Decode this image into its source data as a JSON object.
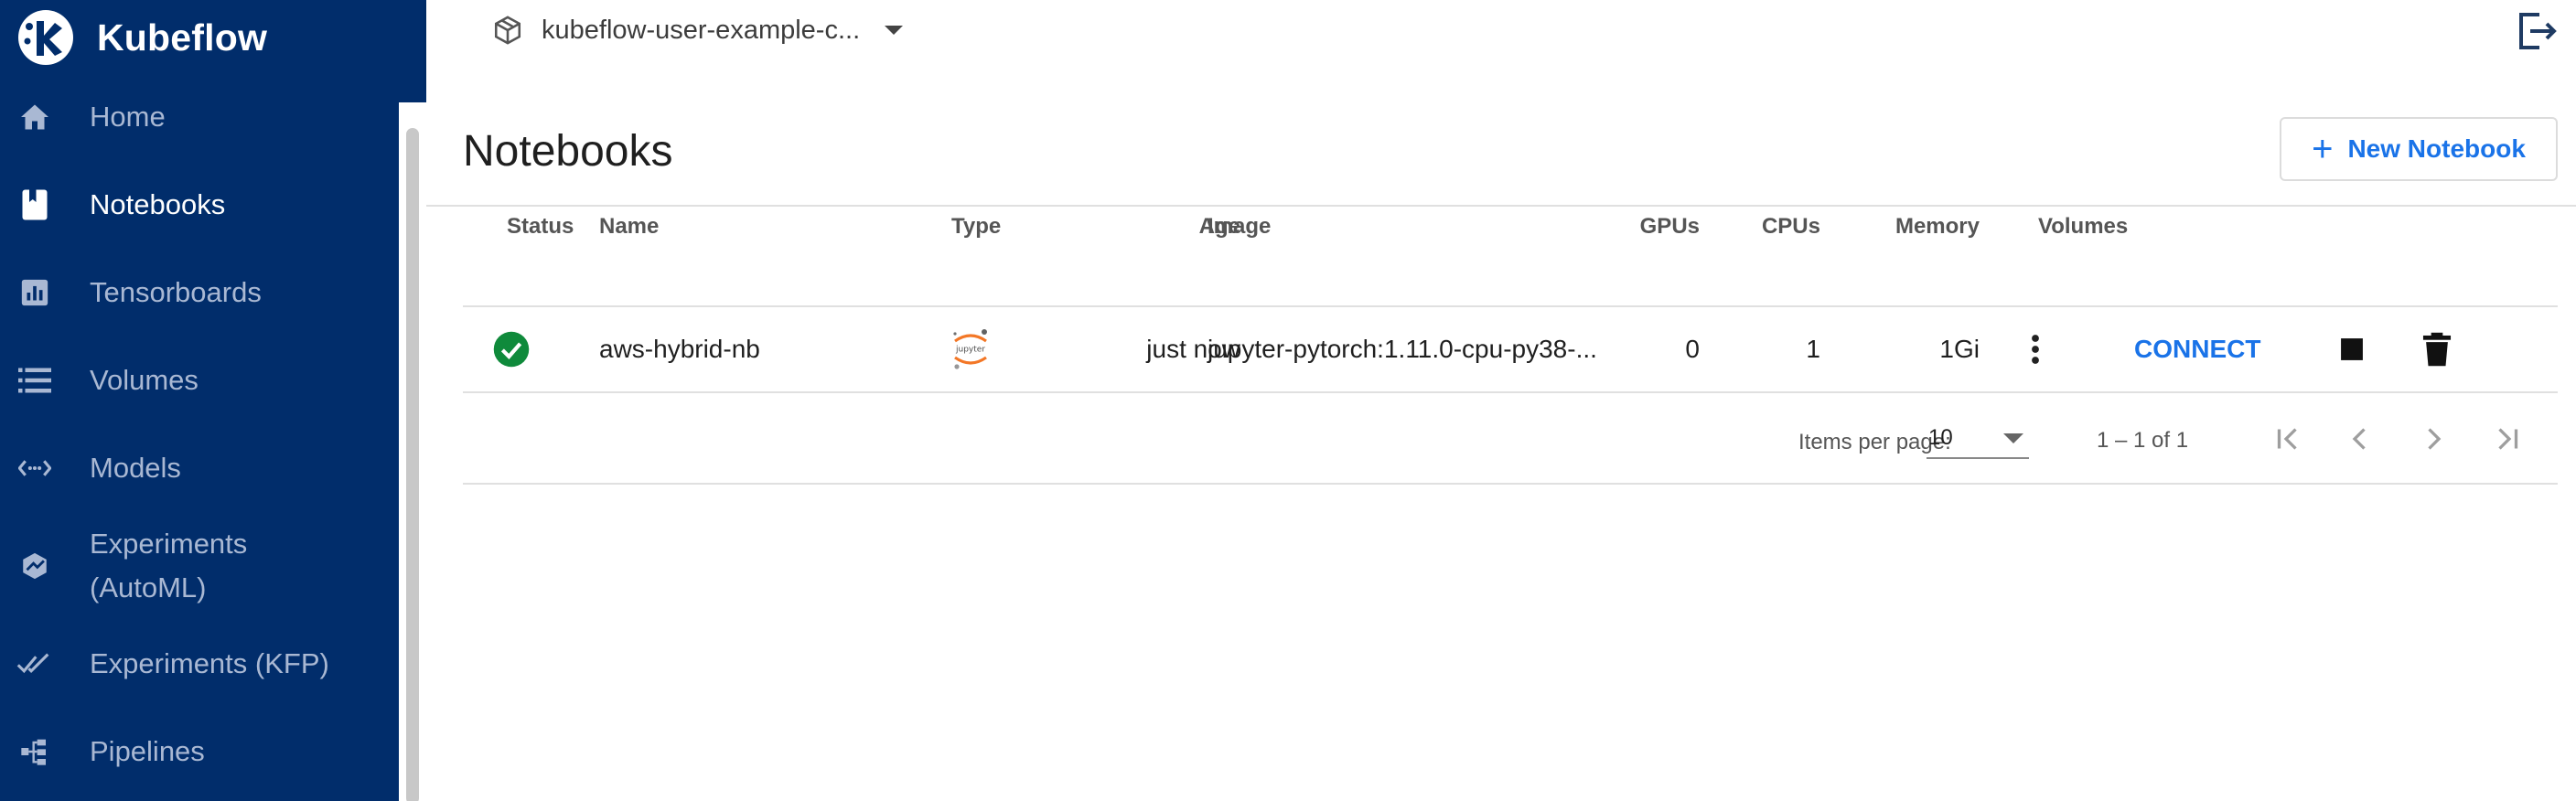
{
  "brand": {
    "name": "Kubeflow"
  },
  "sidebar": {
    "items": [
      {
        "label": "Home",
        "icon": "home-icon"
      },
      {
        "label": "Notebooks",
        "icon": "notebook-icon",
        "active": true
      },
      {
        "label": "Tensorboards",
        "icon": "chart-icon"
      },
      {
        "label": "Volumes",
        "icon": "storage-icon"
      },
      {
        "label": "Models",
        "icon": "arrows-icon"
      },
      {
        "label": "Experiments (AutoML)",
        "icon": "automl-icon"
      },
      {
        "label": "Experiments (KFP)",
        "icon": "double-check-icon"
      },
      {
        "label": "Pipelines",
        "icon": "pipeline-icon"
      }
    ]
  },
  "topbar": {
    "namespace": "kubeflow-user-example-c..."
  },
  "page": {
    "title": "Notebooks",
    "new_button_label": "New Notebook"
  },
  "table": {
    "headers": {
      "status": "Status",
      "name": "Name",
      "type": "Type",
      "age": "Age",
      "image": "Image",
      "gpus": "GPUs",
      "cpus": "CPUs",
      "memory": "Memory",
      "volumes": "Volumes"
    },
    "rows": [
      {
        "status": "ready",
        "name": "aws-hybrid-nb",
        "type_logo_text": "jupyter",
        "age": "just now",
        "image": "jupyter-pytorch:1.11.0-cpu-py38-...",
        "gpus": "0",
        "cpus": "1",
        "memory": "1Gi",
        "connect_label": "CONNECT"
      }
    ]
  },
  "pagination": {
    "items_per_page_label": "Items per page:",
    "items_per_page": "10",
    "range": "1 – 1 of 1"
  },
  "colors": {
    "sidebar_bg": "#012d6b",
    "accent": "#1a73e8",
    "status_ok": "#0f8a3b",
    "jupyter_orange": "#f37726"
  }
}
